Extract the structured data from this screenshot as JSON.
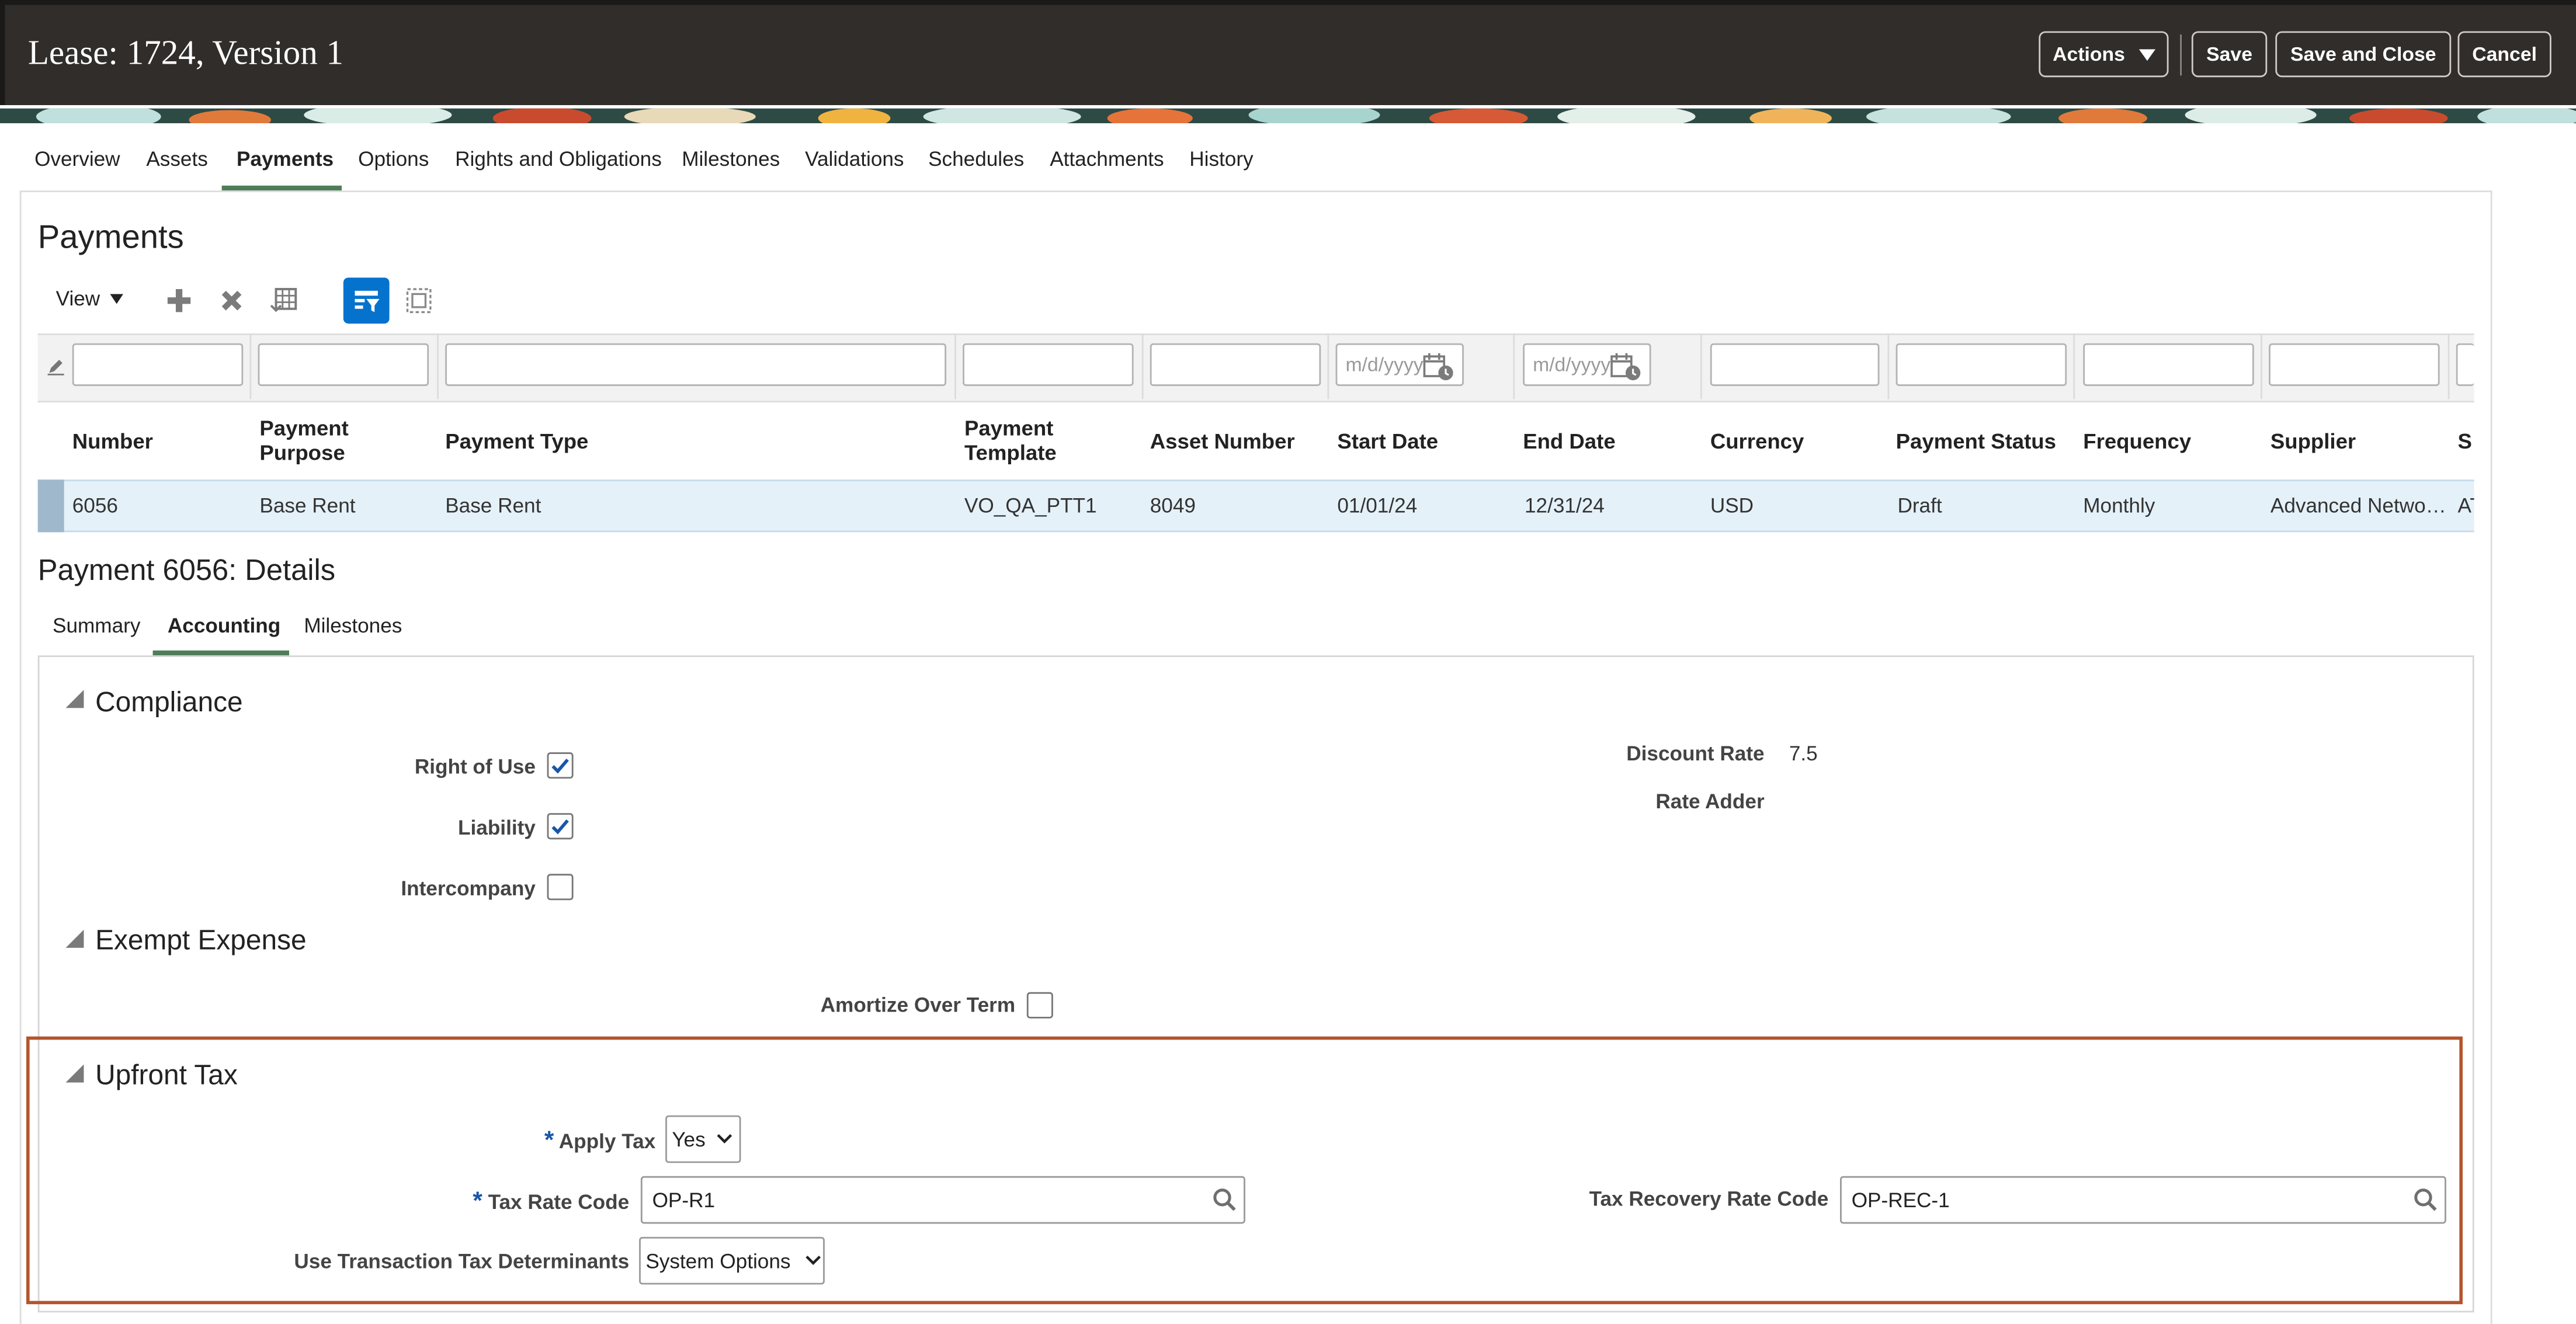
{
  "header": {
    "title": "Lease: 1724, Version 1",
    "actions_label": "Actions",
    "save_label": "Save",
    "save_close_label": "Save and Close",
    "cancel_label": "Cancel"
  },
  "tabs": [
    "Overview",
    "Assets",
    "Payments",
    "Options",
    "Rights and Obligations",
    "Milestones",
    "Validations",
    "Schedules",
    "Attachments",
    "History"
  ],
  "selected_tab": "Payments",
  "payments": {
    "title": "Payments",
    "view_label": "View",
    "date_placeholder": "m/d/yyyy",
    "columns": [
      {
        "line1": "Number",
        "line2": ""
      },
      {
        "line1": "Payment",
        "line2": "Purpose"
      },
      {
        "line1": "Payment Type",
        "line2": ""
      },
      {
        "line1": "Payment",
        "line2": "Template"
      },
      {
        "line1": "Asset Number",
        "line2": ""
      },
      {
        "line1": "Start Date",
        "line2": ""
      },
      {
        "line1": "End Date",
        "line2": ""
      },
      {
        "line1": "Currency",
        "line2": ""
      },
      {
        "line1": "Payment Status",
        "line2": ""
      },
      {
        "line1": "Frequency",
        "line2": ""
      },
      {
        "line1": "Supplier",
        "line2": ""
      },
      {
        "line1": "S",
        "line2": ""
      }
    ],
    "row": [
      "6056",
      "Base Rent",
      "Base Rent",
      "VO_QA_PTT1",
      "8049",
      "01/01/24",
      "12/31/24",
      "USD",
      "Draft",
      "Monthly",
      "Advanced Netwo…",
      "AT"
    ]
  },
  "details": {
    "title": "Payment 6056: Details",
    "subtabs": [
      "Summary",
      "Accounting",
      "Milestones"
    ],
    "selected_subtab": "Accounting",
    "compliance": {
      "header": "Compliance",
      "right_of_use_label": "Right of Use",
      "right_of_use_checked": true,
      "liability_label": "Liability",
      "liability_checked": true,
      "intercompany_label": "Intercompany",
      "intercompany_checked": false,
      "discount_rate_label": "Discount Rate",
      "discount_rate_value": "7.5",
      "rate_adder_label": "Rate Adder"
    },
    "exempt_expense": {
      "header": "Exempt Expense",
      "amortize_label": "Amortize Over Term",
      "amortize_checked": false
    },
    "upfront_tax": {
      "header": "Upfront Tax",
      "apply_tax_label": "Apply Tax",
      "apply_tax_value": "Yes",
      "tax_rate_code_label": "Tax Rate Code",
      "tax_rate_code_value": "OP-R1",
      "tax_recovery_label": "Tax Recovery Rate Code",
      "tax_recovery_value": "OP-REC-1",
      "use_ttd_label": "Use Transaction Tax Determinants",
      "use_ttd_value": "System Options",
      "required_mark": "*"
    }
  },
  "colors": {
    "header_bg": "#312d2a",
    "tab_underline": "#4f7d5a",
    "selected_row": "#e5f1f9",
    "active_tool": "#0572ce",
    "highlight_border": "#b5542b",
    "checkbox_check": "#1a56a8"
  }
}
